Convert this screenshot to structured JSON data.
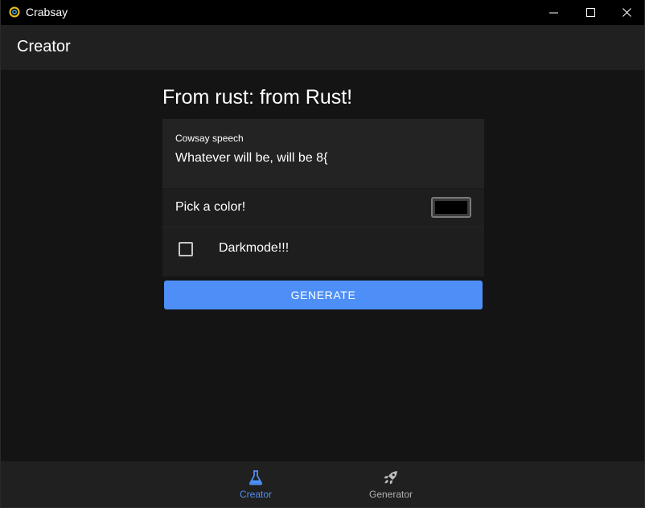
{
  "window": {
    "title": "Crabsay"
  },
  "appbar": {
    "title": "Creator"
  },
  "main": {
    "heading": "From rust: from Rust!",
    "speech": {
      "label": "Cowsay speech",
      "value": "Whatever will be, will be 8{"
    },
    "color_picker": {
      "label": "Pick a color!",
      "value": "#000000"
    },
    "darkmode": {
      "label": "Darkmode!!!",
      "checked": false
    },
    "generate_label": "GENERATE"
  },
  "bottom_nav": {
    "items": [
      {
        "label": "Creator",
        "icon": "flask-icon",
        "active": true
      },
      {
        "label": "Generator",
        "icon": "rocket-icon",
        "active": false
      }
    ]
  },
  "colors": {
    "accent": "#4d8ff7",
    "background": "#141414",
    "surface": "#202020"
  }
}
